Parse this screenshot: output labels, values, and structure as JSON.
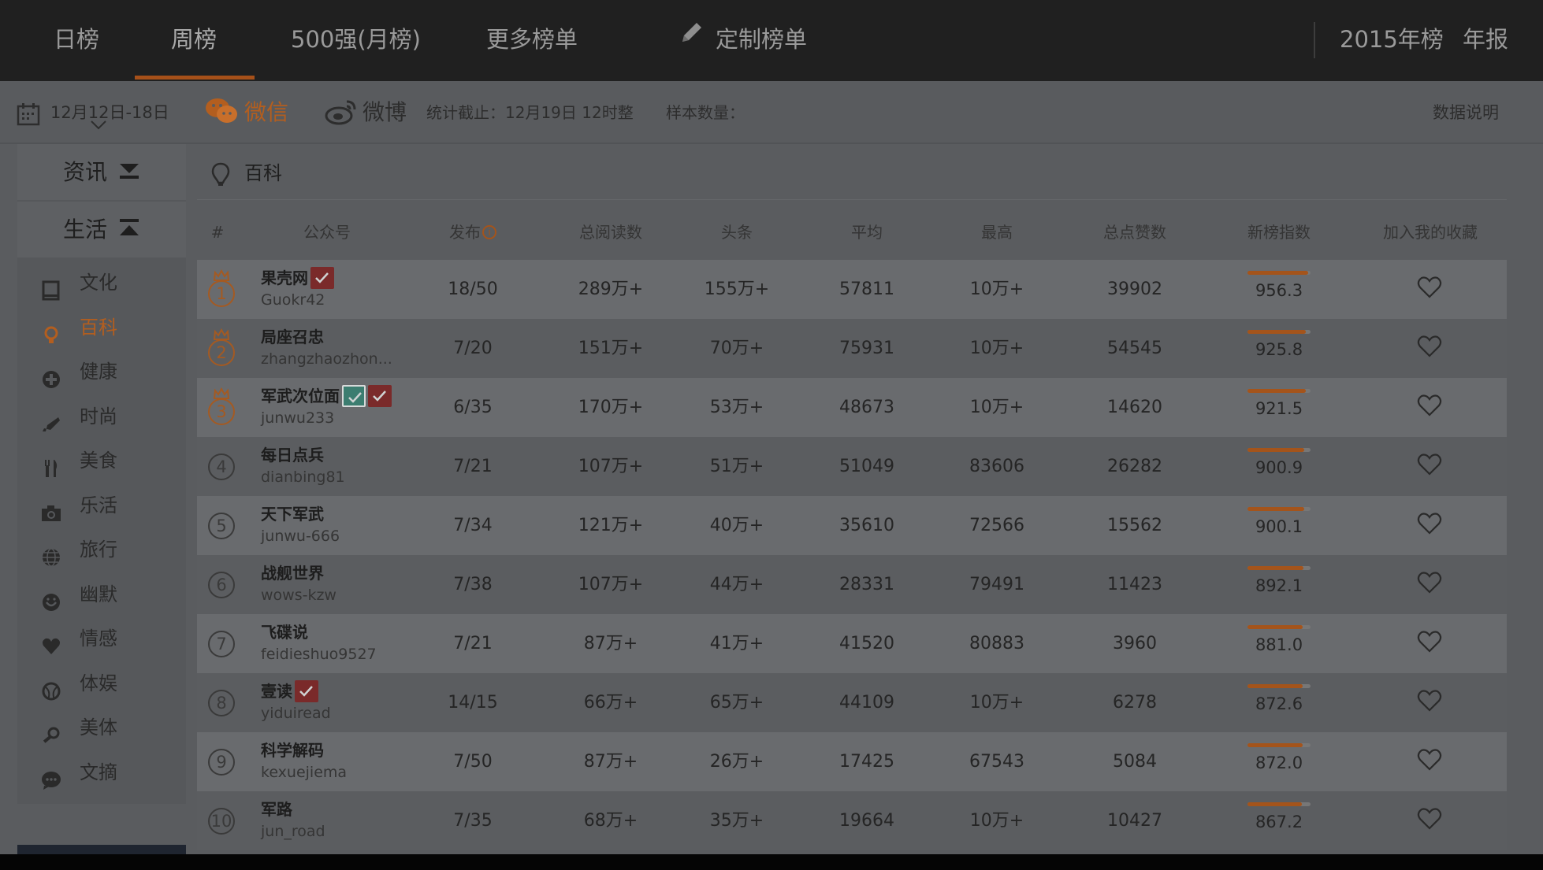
{
  "topnav": {
    "items": [
      "日榜",
      "周榜",
      "500强(月榜)",
      "更多榜单"
    ],
    "custom": "定制榜单",
    "right": [
      "2015年榜",
      "年报"
    ]
  },
  "subbar": {
    "date": "12月12日-18日",
    "wechat": "微信",
    "weibo": "微博",
    "stat": "统计截止：12月19日 12时整",
    "sample": "样本数量：",
    "explain": "数据说明"
  },
  "sidebar": {
    "heads": [
      "资讯",
      "生活"
    ],
    "items": [
      {
        "label": "文化",
        "icon": "book-icon"
      },
      {
        "label": "百科",
        "icon": "lightbulb-icon"
      },
      {
        "label": "健康",
        "icon": "plus-circle-icon"
      },
      {
        "label": "时尚",
        "icon": "heel-icon"
      },
      {
        "label": "美食",
        "icon": "fork-knife-icon"
      },
      {
        "label": "乐活",
        "icon": "camera-icon"
      },
      {
        "label": "旅行",
        "icon": "globe-icon"
      },
      {
        "label": "幽默",
        "icon": "smile-icon"
      },
      {
        "label": "情感",
        "icon": "heart-icon"
      },
      {
        "label": "体娱",
        "icon": "ball-icon"
      },
      {
        "label": "美体",
        "icon": "dumbbell-icon"
      },
      {
        "label": "文摘",
        "icon": "chat-icon"
      }
    ],
    "active_index": 1
  },
  "main": {
    "title": "百科",
    "headers": [
      "#",
      "公众号",
      "发布",
      "总阅读数",
      "头条",
      "平均",
      "最高",
      "总点赞数",
      "新榜指数",
      "加入我的收藏"
    ]
  },
  "rows": [
    {
      "rank": "1",
      "name": "果壳网",
      "id": "Guokr42",
      "pub": "18/50",
      "total": "289万+",
      "head": "155万+",
      "avg": "57811",
      "max": "10万+",
      "likes": "39902",
      "index": "956.3",
      "index_frac": 0.96,
      "badges": [
        "red"
      ]
    },
    {
      "rank": "2",
      "name": "局座召忠",
      "id": "zhangzhaozhon...",
      "pub": "7/20",
      "total": "151万+",
      "head": "70万+",
      "avg": "75931",
      "max": "10万+",
      "likes": "54545",
      "index": "925.8",
      "index_frac": 0.93,
      "badges": []
    },
    {
      "rank": "3",
      "name": "军武次位面",
      "id": "junwu233",
      "pub": "6/35",
      "total": "170万+",
      "head": "53万+",
      "avg": "48673",
      "max": "10万+",
      "likes": "14620",
      "index": "921.5",
      "index_frac": 0.92,
      "badges": [
        "green",
        "red"
      ]
    },
    {
      "rank": "4",
      "name": "每日点兵",
      "id": "dianbing81",
      "pub": "7/21",
      "total": "107万+",
      "head": "51万+",
      "avg": "51049",
      "max": "83606",
      "likes": "26282",
      "index": "900.9",
      "index_frac": 0.9,
      "badges": []
    },
    {
      "rank": "5",
      "name": "天下军武",
      "id": "junwu-666",
      "pub": "7/34",
      "total": "121万+",
      "head": "40万+",
      "avg": "35610",
      "max": "72566",
      "likes": "15562",
      "index": "900.1",
      "index_frac": 0.9,
      "badges": []
    },
    {
      "rank": "6",
      "name": "战舰世界",
      "id": "wows-kzw",
      "pub": "7/38",
      "total": "107万+",
      "head": "44万+",
      "avg": "28331",
      "max": "79491",
      "likes": "11423",
      "index": "892.1",
      "index_frac": 0.89,
      "badges": []
    },
    {
      "rank": "7",
      "name": "飞碟说",
      "id": "feidieshuo9527",
      "pub": "7/21",
      "total": "87万+",
      "head": "41万+",
      "avg": "41520",
      "max": "80883",
      "likes": "3960",
      "index": "881.0",
      "index_frac": 0.88,
      "badges": []
    },
    {
      "rank": "8",
      "name": "壹读",
      "id": "yiduiread",
      "pub": "14/15",
      "total": "66万+",
      "head": "65万+",
      "avg": "44109",
      "max": "10万+",
      "likes": "6278",
      "index": "872.6",
      "index_frac": 0.87,
      "badges": [
        "red"
      ]
    },
    {
      "rank": "9",
      "name": "科学解码",
      "id": "kexuejiema",
      "pub": "7/50",
      "total": "87万+",
      "head": "26万+",
      "avg": "17425",
      "max": "67543",
      "likes": "5084",
      "index": "872.0",
      "index_frac": 0.87,
      "badges": []
    },
    {
      "rank": "10",
      "name": "军路",
      "id": "jun_road",
      "pub": "7/35",
      "total": "68万+",
      "head": "35万+",
      "avg": "19664",
      "max": "10万+",
      "likes": "10427",
      "index": "867.2",
      "index_frac": 0.86,
      "badges": []
    }
  ]
}
